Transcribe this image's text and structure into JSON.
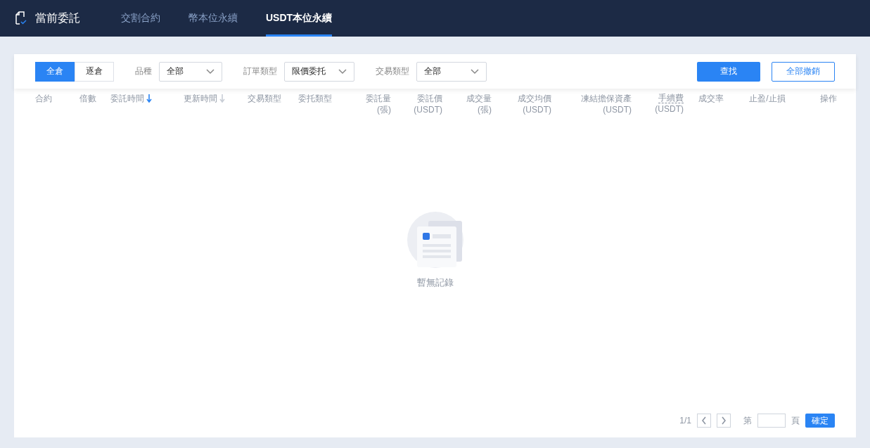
{
  "header": {
    "title": "當前委託",
    "tabs": [
      {
        "label": "交割合約",
        "selected": false
      },
      {
        "label": "幣本位永續",
        "selected": false
      },
      {
        "label": "USDT本位永續",
        "selected": true
      }
    ]
  },
  "filters": {
    "margin_modes": [
      {
        "label": "全倉",
        "selected": true
      },
      {
        "label": "逐倉",
        "selected": false
      }
    ],
    "selects": [
      {
        "label": "品種",
        "value": "全部"
      },
      {
        "label": "訂單類型",
        "value": "限價委托"
      },
      {
        "label": "交易類型",
        "value": "全部"
      }
    ],
    "search_button": "查找",
    "cancel_all_button": "全部撤銷"
  },
  "table": {
    "columns": [
      {
        "lines": [
          "合約"
        ]
      },
      {
        "lines": [
          "倍數"
        ]
      },
      {
        "lines": [
          "委託時間"
        ],
        "sort_active": true
      },
      {
        "lines": [
          "更新時間"
        ],
        "sort_active": false
      },
      {
        "lines": [
          "交易類型"
        ]
      },
      {
        "lines": [
          "委托類型"
        ]
      },
      {
        "lines": [
          "委託量",
          "(張)"
        ]
      },
      {
        "lines": [
          "委託價",
          "(USDT)"
        ]
      },
      {
        "lines": [
          "成交量",
          "(張)"
        ]
      },
      {
        "lines": [
          "成交均價",
          "(USDT)"
        ]
      },
      {
        "lines": [
          "凍結擔保資產",
          "(USDT)"
        ]
      },
      {
        "lines": [
          "手續費",
          "(USDT)"
        ],
        "tooltip": true
      },
      {
        "lines": [
          "成交率"
        ]
      },
      {
        "lines": [
          "止盈/止損"
        ]
      },
      {
        "lines": [
          "操作"
        ]
      }
    ],
    "empty_text": "暫無記錄"
  },
  "pagination": {
    "pages": "1/1",
    "page_prefix": "第",
    "page_suffix": "頁",
    "confirm": "確定"
  }
}
